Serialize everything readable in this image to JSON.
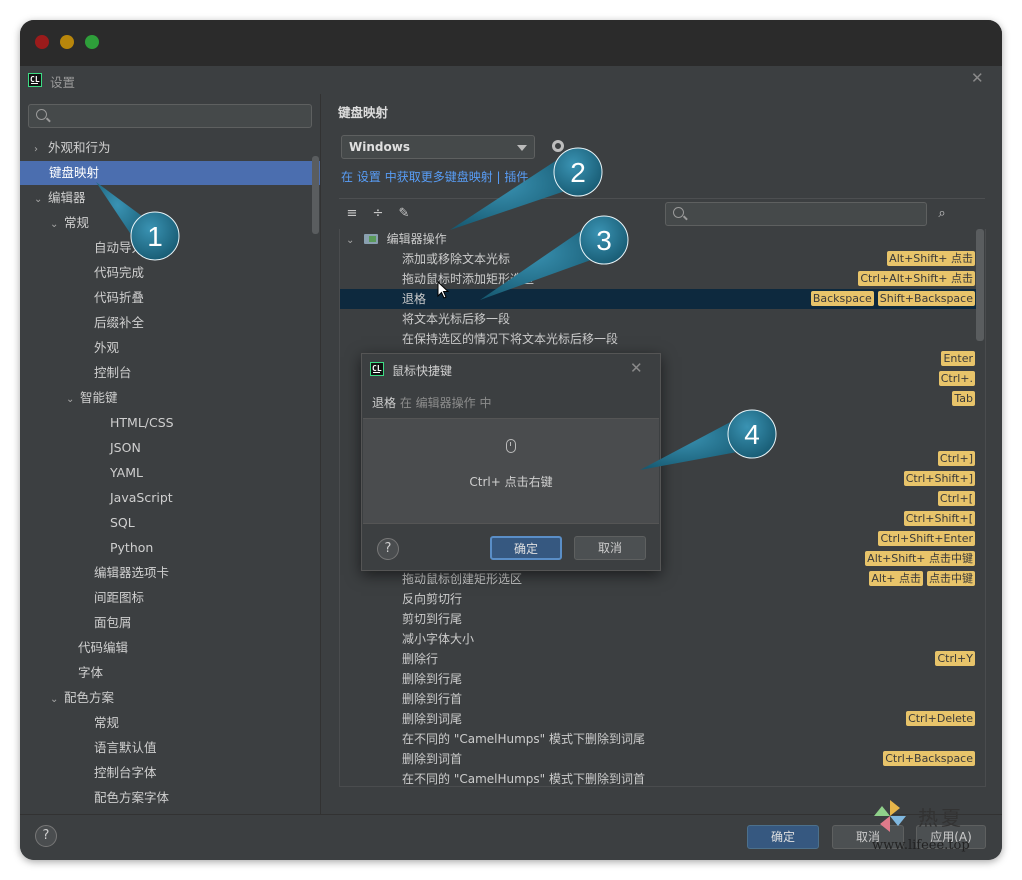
{
  "window": {
    "title": "设置"
  },
  "sidebar": {
    "search_placeholder": "",
    "items": [
      {
        "label": "外观和行为",
        "expander": "›"
      },
      {
        "label": "键盘映射"
      },
      {
        "label": "编辑器",
        "expander": "⌄"
      },
      {
        "label": "常规",
        "expander": "⌄"
      },
      {
        "label": "自动导入"
      },
      {
        "label": "代码完成"
      },
      {
        "label": "代码折叠"
      },
      {
        "label": "后缀补全"
      },
      {
        "label": "外观"
      },
      {
        "label": "控制台"
      },
      {
        "label": "智能键",
        "expander": "⌄"
      },
      {
        "label": "HTML/CSS"
      },
      {
        "label": "JSON"
      },
      {
        "label": "YAML"
      },
      {
        "label": "JavaScript"
      },
      {
        "label": "SQL"
      },
      {
        "label": "Python"
      },
      {
        "label": "编辑器选项卡"
      },
      {
        "label": "间距图标"
      },
      {
        "label": "面包屑"
      },
      {
        "label": "代码编辑"
      },
      {
        "label": "字体"
      },
      {
        "label": "配色方案",
        "expander": "⌄"
      },
      {
        "label": "常规"
      },
      {
        "label": "语言默认值"
      },
      {
        "label": "控制台字体"
      },
      {
        "label": "配色方案字体"
      }
    ]
  },
  "main": {
    "section_title": "键盘映射",
    "keymap_value": "Windows",
    "link_prefix": "在",
    "link_settings": "设置",
    "link_middle": "中获取更多键盘映射",
    "link_sep": "|",
    "link_plugins": "插件",
    "group_label": "编辑器操作",
    "actions": [
      {
        "label": "添加或移除文本光标",
        "shortcuts": [
          "Alt+Shift+ 点击"
        ]
      },
      {
        "label": "拖动鼠标时添加矩形选区",
        "shortcuts": [
          "Ctrl+Alt+Shift+ 点击"
        ]
      },
      {
        "label": "退格",
        "shortcuts": [
          "Backspace",
          "Shift+Backspace"
        ]
      },
      {
        "label": "将文本光标后移一段",
        "shortcuts": []
      },
      {
        "label": "在保持选区的情况下将文本光标后移一段",
        "shortcuts": []
      },
      {
        "label": "",
        "shortcuts": [
          "Enter"
        ]
      },
      {
        "label": "",
        "shortcuts": [
          "Ctrl+."
        ]
      },
      {
        "label": "",
        "shortcuts": [
          "Tab"
        ]
      },
      {
        "label": "",
        "shortcuts": []
      },
      {
        "label": "",
        "shortcuts": []
      },
      {
        "label": "",
        "shortcuts": [
          "Ctrl+]"
        ]
      },
      {
        "label": "",
        "shortcuts": [
          "Ctrl+Shift+]"
        ]
      },
      {
        "label": "",
        "shortcuts": [
          "Ctrl+["
        ]
      },
      {
        "label": "",
        "shortcuts": [
          "Ctrl+Shift+["
        ]
      },
      {
        "label": "",
        "shortcuts": [
          "Ctrl+Shift+Enter"
        ]
      },
      {
        "label": "",
        "shortcuts": [
          "Alt+Shift+ 点击中键"
        ]
      },
      {
        "label": "拖动鼠标创建矩形选区",
        "shortcuts": [
          "Alt+ 点击",
          "点击中键"
        ]
      },
      {
        "label": "反向剪切行",
        "shortcuts": []
      },
      {
        "label": "剪切到行尾",
        "shortcuts": []
      },
      {
        "label": "减小字体大小",
        "shortcuts": []
      },
      {
        "label": "删除行",
        "shortcuts": [
          "Ctrl+Y"
        ]
      },
      {
        "label": "删除到行尾",
        "shortcuts": []
      },
      {
        "label": "删除到行首",
        "shortcuts": []
      },
      {
        "label": "删除到词尾",
        "shortcuts": [
          "Ctrl+Delete"
        ]
      },
      {
        "label": "在不同的 \"CamelHumps\" 模式下删除到词尾",
        "shortcuts": []
      },
      {
        "label": "删除到词首",
        "shortcuts": [
          "Ctrl+Backspace"
        ]
      },
      {
        "label": "在不同的 \"CamelHumps\" 模式下删除到词首",
        "shortcuts": []
      }
    ]
  },
  "popup": {
    "title": "鼠标快捷键",
    "action_name": "退格",
    "context": "在 编辑器操作 中",
    "shortcut_text": "Ctrl+ 点击右键",
    "ok_label": "确定",
    "cancel_label": "取消",
    "help_label": "?"
  },
  "bottom": {
    "help_label": "?",
    "ok_label": "确定",
    "cancel_label": "取消",
    "apply_label": "应用(A)"
  },
  "callouts": [
    "1",
    "2",
    "3",
    "4"
  ],
  "watermark": {
    "text": "热夏",
    "url": "www.lifeee.top"
  },
  "colors": {
    "selection": "#4b6eaf",
    "shortcut_badge": "#e8c46a",
    "link": "#589df6",
    "callout": "#1f6f8b"
  }
}
